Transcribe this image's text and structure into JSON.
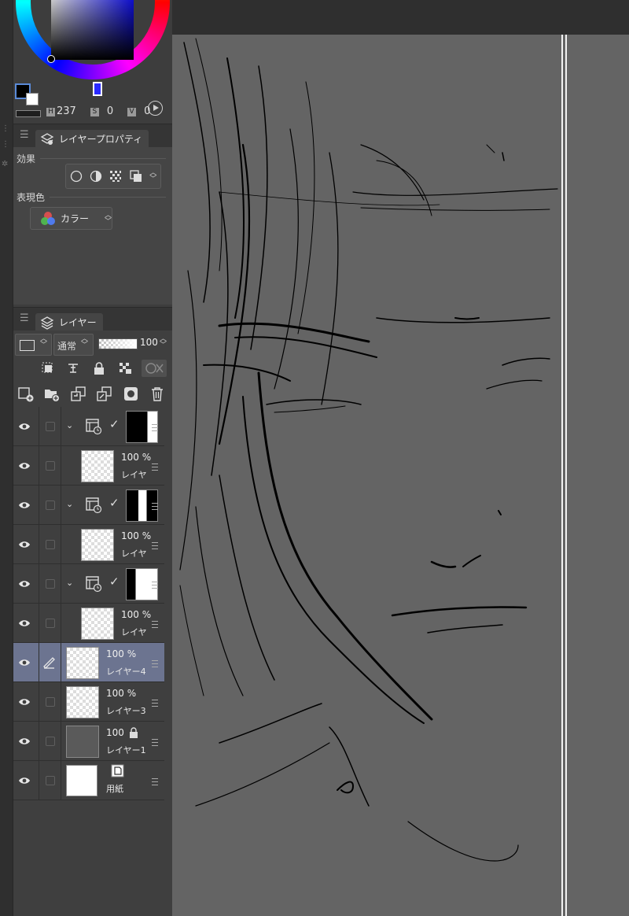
{
  "color_picker": {
    "h_label": "H",
    "h_value": "237",
    "s_label": "S",
    "s_value": "0",
    "v_label": "V",
    "v_value": "0",
    "main_color": "#000000",
    "sub_color": "#ffffff"
  },
  "layer_property": {
    "tab_label": "レイヤープロパティ",
    "effect_label": "効果",
    "expression_color_label": "表現色",
    "expression_color_value": "カラー"
  },
  "layer_panel": {
    "tab_label": "レイヤー",
    "blend_mode": "通常",
    "opacity": "100",
    "layers": [
      {
        "type": "folder",
        "mask": "left-black"
      },
      {
        "type": "raster",
        "percent": "100 %",
        "name": "レイヤ"
      },
      {
        "type": "folder",
        "mask": "center-white"
      },
      {
        "type": "raster",
        "percent": "100 %",
        "name": "レイヤ"
      },
      {
        "type": "folder",
        "mask": "right-black"
      },
      {
        "type": "raster",
        "percent": "100 %",
        "name": "レイヤ"
      },
      {
        "type": "raster",
        "percent": "100 %",
        "name": "レイヤー4",
        "active": true
      },
      {
        "type": "raster",
        "percent": "100 %",
        "name": "レイヤー3"
      },
      {
        "type": "raster",
        "percent": "100",
        "name": "レイヤー1",
        "locked": true
      },
      {
        "type": "paper",
        "name": "用紙"
      }
    ]
  },
  "colors": {
    "canvas_bg": "#646464",
    "panel_bg": "#3d3d3d",
    "active_layer": "#6c7490"
  }
}
